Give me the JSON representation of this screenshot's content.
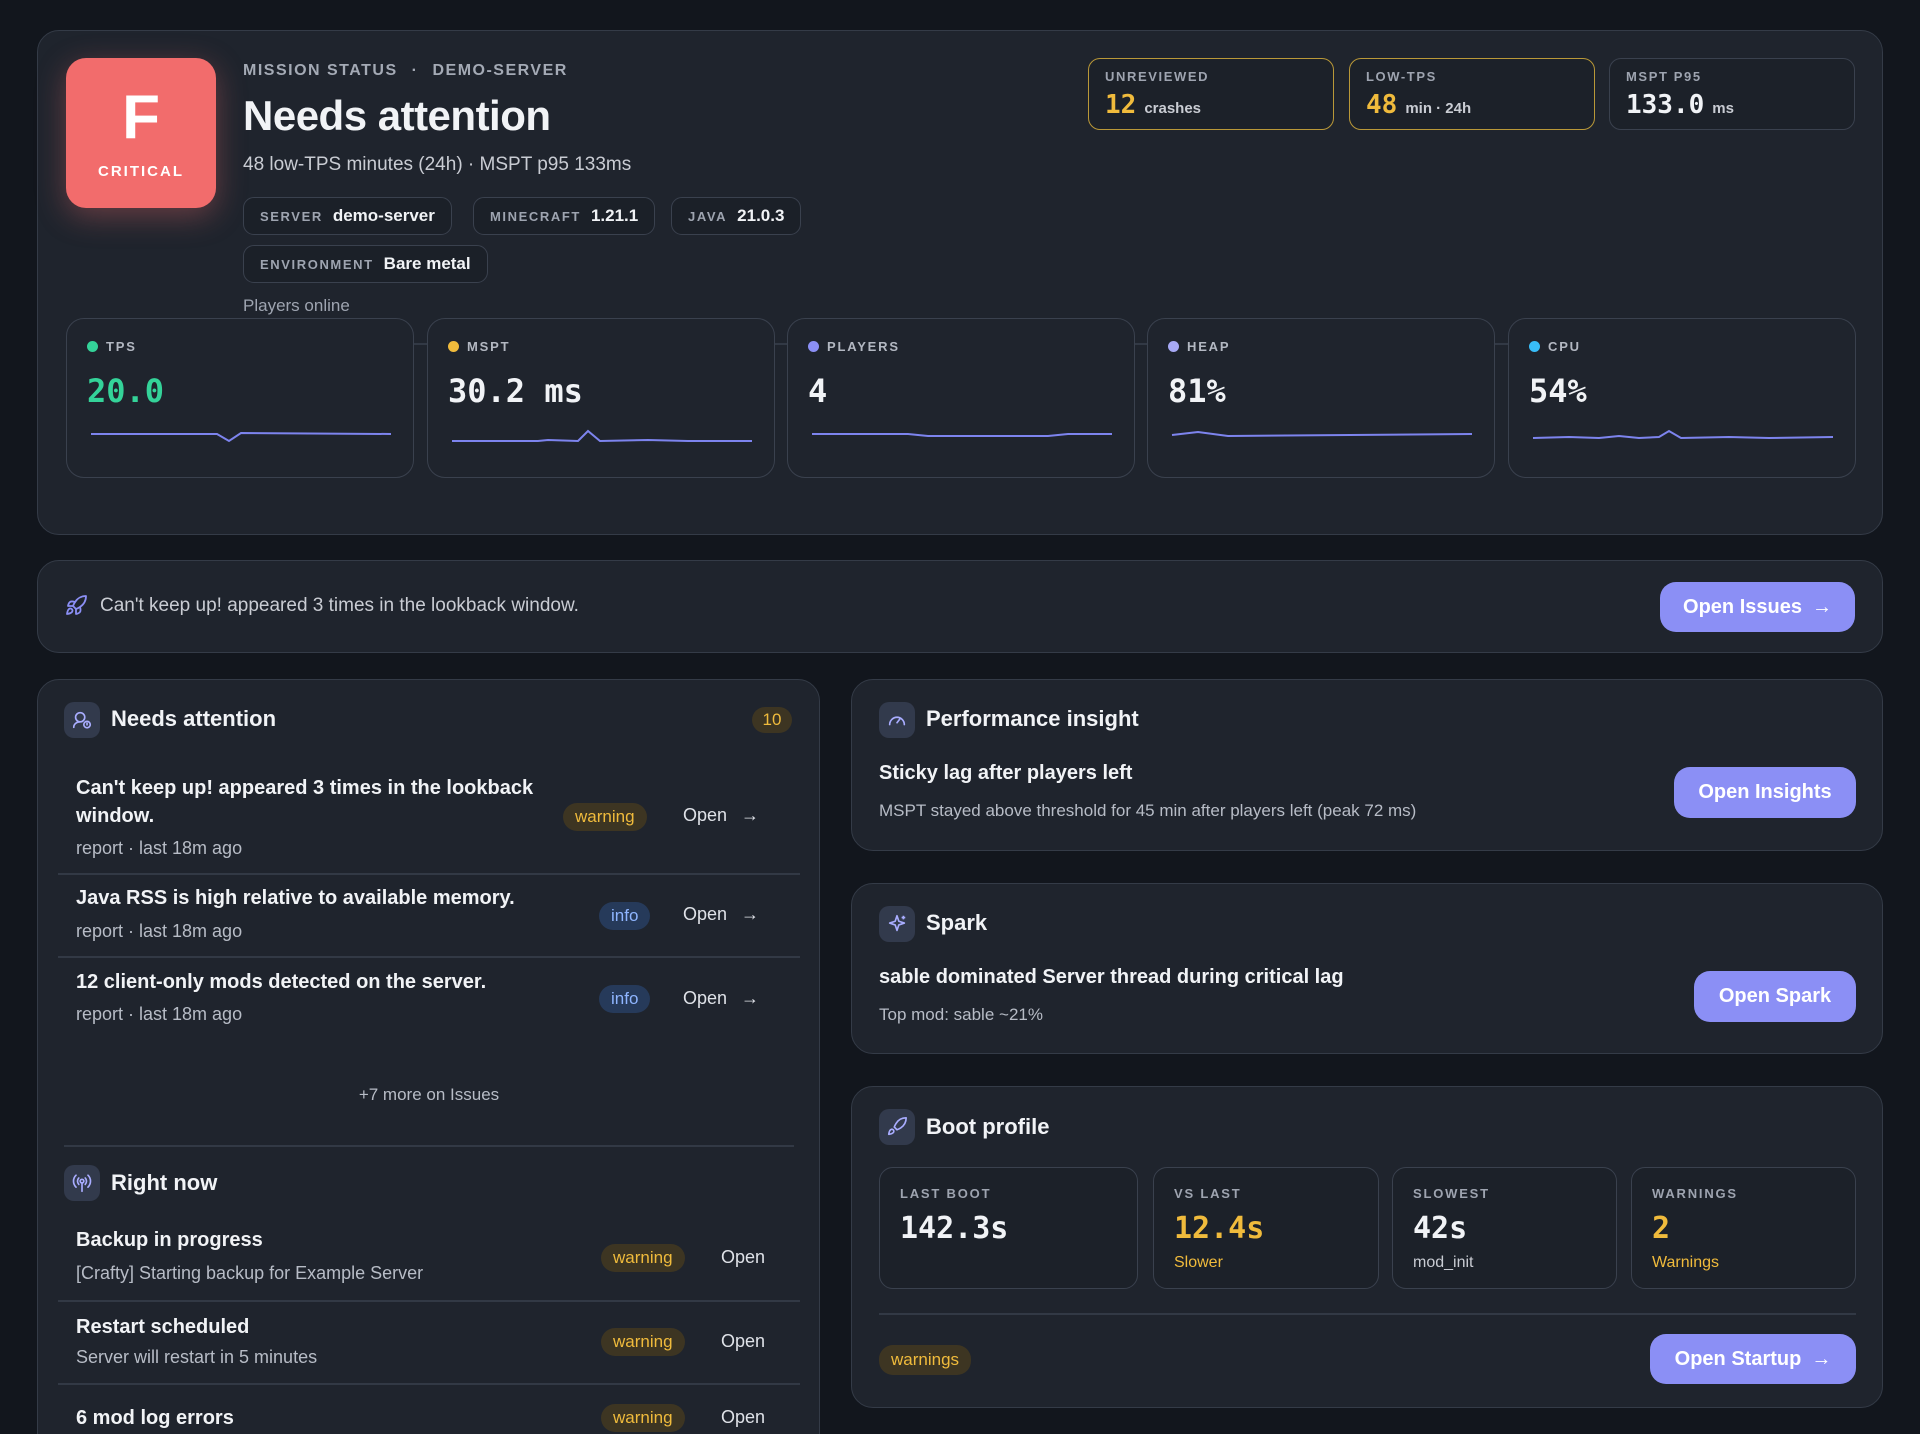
{
  "colors": {
    "accent": "#8b8ff5",
    "critical": "#f26c6c",
    "warning": "#f0bb3c",
    "info": "#8fb5ff",
    "good": "#34d399"
  },
  "mission": {
    "grade": "F",
    "grade_label": "CRITICAL",
    "kicker": "MISSION STATUS",
    "kicker_sep": "·",
    "server_slug": "DEMO-SERVER",
    "title": "Needs attention",
    "subtitle": "48 low-TPS minutes (24h) · MSPT p95 133ms",
    "pills": [
      {
        "key": "SERVER",
        "value": "demo-server"
      },
      {
        "key": "MINECRAFT",
        "value": "1.21.1"
      },
      {
        "key": "JAVA",
        "value": "21.0.3"
      },
      {
        "key": "ENVIRONMENT",
        "value": "Bare metal"
      }
    ],
    "players_online_label": "Players online",
    "stats": [
      {
        "label": "UNREVIEWED",
        "value": "12",
        "unit": "crashes"
      },
      {
        "label": "LOW-TPS",
        "value": "48",
        "unit": "min · 24h"
      },
      {
        "label": "MSPT P95",
        "value": "133.0",
        "unit": "ms"
      }
    ]
  },
  "metrics": [
    {
      "label": "TPS",
      "value": "20.0",
      "dot": "#34d399",
      "value_color": "#34d399"
    },
    {
      "label": "MSPT",
      "value": "30.2 ms",
      "dot": "#f0bb3c",
      "value_color": "#f1f3f6"
    },
    {
      "label": "PLAYERS",
      "value": "4",
      "dot": "#8b8ff5",
      "value_color": "#f1f3f6"
    },
    {
      "label": "HEAP",
      "value": "81%",
      "dot": "#a7a9f5",
      "value_color": "#f1f3f6"
    },
    {
      "label": "CPU",
      "value": "54%",
      "dot": "#38bdf8",
      "value_color": "#f1f3f6"
    }
  ],
  "banner": {
    "text": "Can't keep up! appeared 3 times in the lookback window.",
    "button": "Open Issues"
  },
  "attention": {
    "title": "Needs attention",
    "count": "10",
    "items": [
      {
        "title": "Can't keep up! appeared 3 times in the lookback window.",
        "sub": "report · last 18m ago",
        "tag": "warning",
        "action": "Open"
      },
      {
        "title": "Java RSS is high relative to available memory.",
        "sub": "report · last 18m ago",
        "tag": "info",
        "action": "Open"
      },
      {
        "title": "12 client-only mods detected on the server.",
        "sub": "report · last 18m ago",
        "tag": "info",
        "action": "Open"
      }
    ],
    "more": "+7 more on Issues"
  },
  "right_now": {
    "title": "Right now",
    "items": [
      {
        "title": "Backup in progress",
        "sub": "[Crafty] Starting backup for Example Server",
        "tag": "warning",
        "action": "Open"
      },
      {
        "title": "Restart scheduled",
        "sub": "Server will restart in 5 minutes",
        "tag": "warning",
        "action": "Open"
      },
      {
        "title": "6 mod log errors",
        "sub": "",
        "tag": "warning",
        "action": "Open"
      }
    ]
  },
  "performance": {
    "title": "Performance insight",
    "headline": "Sticky lag after players left",
    "detail": "MSPT stayed above threshold for 45 min after players left (peak 72 ms)",
    "button": "Open Insights"
  },
  "spark": {
    "title": "Spark",
    "headline": "sable dominated Server thread during critical lag",
    "detail": "Top mod: sable ~21%",
    "button": "Open Spark"
  },
  "boot": {
    "title": "Boot profile",
    "boxes": [
      {
        "label": "LAST BOOT",
        "value": "142.3s",
        "sub": ""
      },
      {
        "label": "VS LAST",
        "value": "12.4s",
        "sub": "Slower"
      },
      {
        "label": "SLOWEST",
        "value": "42s",
        "sub": "mod_init"
      },
      {
        "label": "WARNINGS",
        "value": "2",
        "sub": "Warnings"
      }
    ],
    "tag": "warnings",
    "button": "Open Startup"
  }
}
